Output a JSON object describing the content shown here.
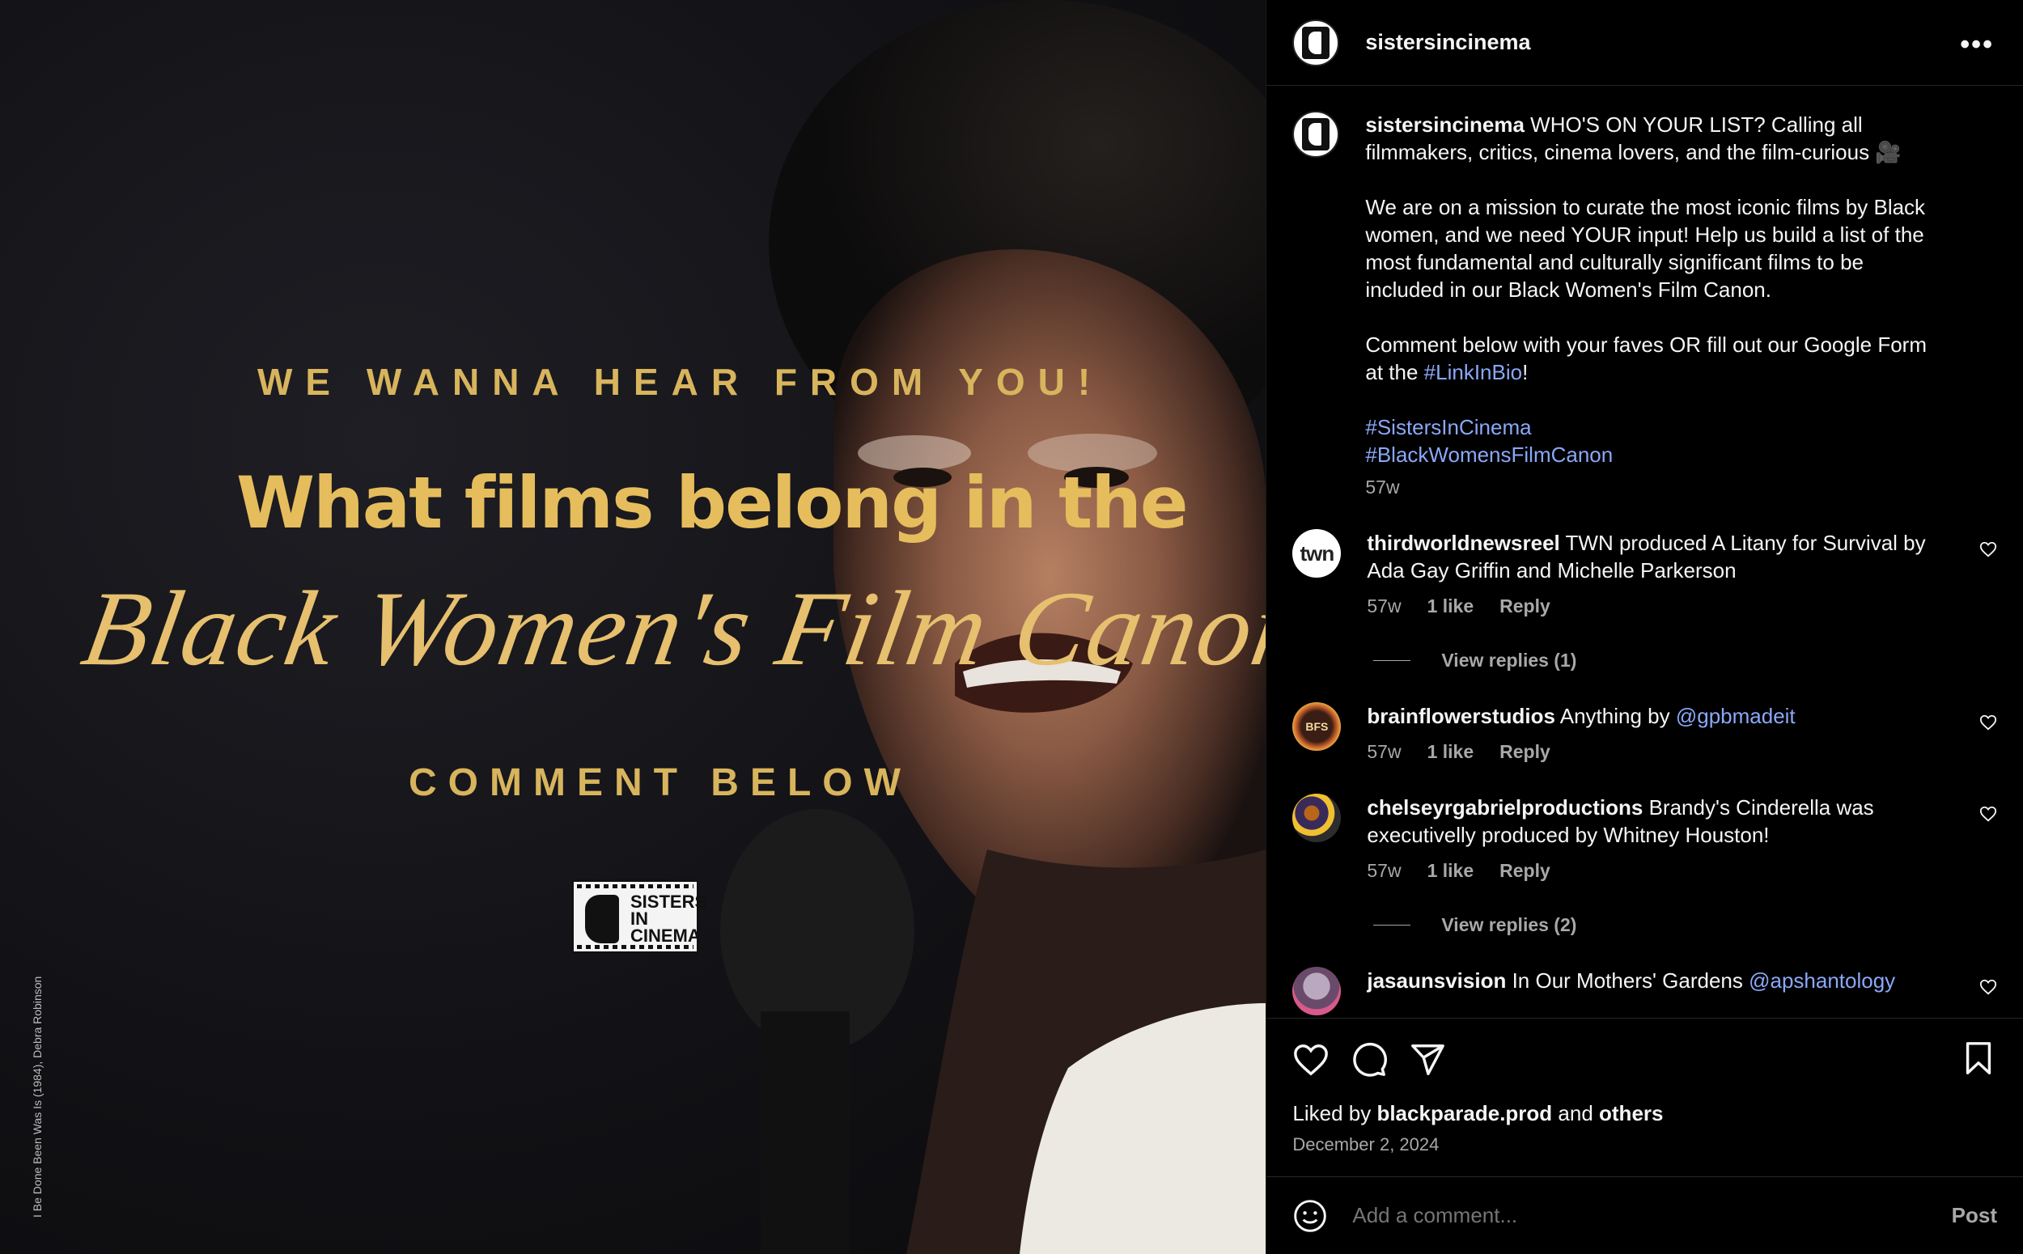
{
  "media": {
    "line1": "WE WANNA HEAR FROM YOU!",
    "line2": "What films belong in the",
    "line3": "Black Women's Film Canon?",
    "line4": "COMMENT BELOW",
    "logo_text_1": "SISTERS",
    "logo_text_2": "IN CINEMA",
    "credit": "I Be Done Been Was Is (1984), Debra Robinson"
  },
  "header": {
    "username": "sistersincinema",
    "more_label": "•••"
  },
  "caption": {
    "username": "sistersincinema",
    "para1": "WHO'S ON YOUR LIST? Calling all filmmakers, critics, cinema lovers, and the film-curious 🎥",
    "para2": "We are on a mission to curate the most iconic films by Black women, and we need YOUR input! Help us build a list of the most fundamental and culturally significant films to be included in our Black Women's Film Canon.",
    "para3_pre": "Comment below with your faves OR fill out our Google Form at the ",
    "para3_link": "#LinkInBio",
    "para3_post": "!",
    "hashtag1": "#SistersInCinema",
    "hashtag2": "#BlackWomensFilmCanon",
    "time": "57w"
  },
  "comments": [
    {
      "avatar_text": "twn",
      "username": "thirdworldnewsreel",
      "text": "TWN produced A Litany for Survival by Ada Gay Griffin and Michelle Parkerson",
      "time": "57w",
      "likes": "1 like",
      "reply": "Reply",
      "view_replies": "View replies (1)"
    },
    {
      "avatar_text": "BFS",
      "username": "brainflowerstudios",
      "text": "Anything by ",
      "mention": "@gpbmadeit",
      "time": "57w",
      "likes": "1 like",
      "reply": "Reply"
    },
    {
      "username": "chelseyrgabrielproductions",
      "text": "Brandy's Cinderella was executivelly produced by Whitney Houston!",
      "time": "57w",
      "likes": "1 like",
      "reply": "Reply",
      "view_replies": "View replies (2)"
    },
    {
      "username": "jasaunsvision",
      "text": "In Our Mothers' Gardens ",
      "mention": "@apshantology"
    }
  ],
  "actions": {
    "liked_prefix": "Liked by ",
    "liked_user": "blackparade.prod",
    "liked_mid": " and ",
    "liked_others": "others",
    "date": "December 2, 2024"
  },
  "add_comment": {
    "placeholder": "Add a comment...",
    "post_label": "Post"
  }
}
